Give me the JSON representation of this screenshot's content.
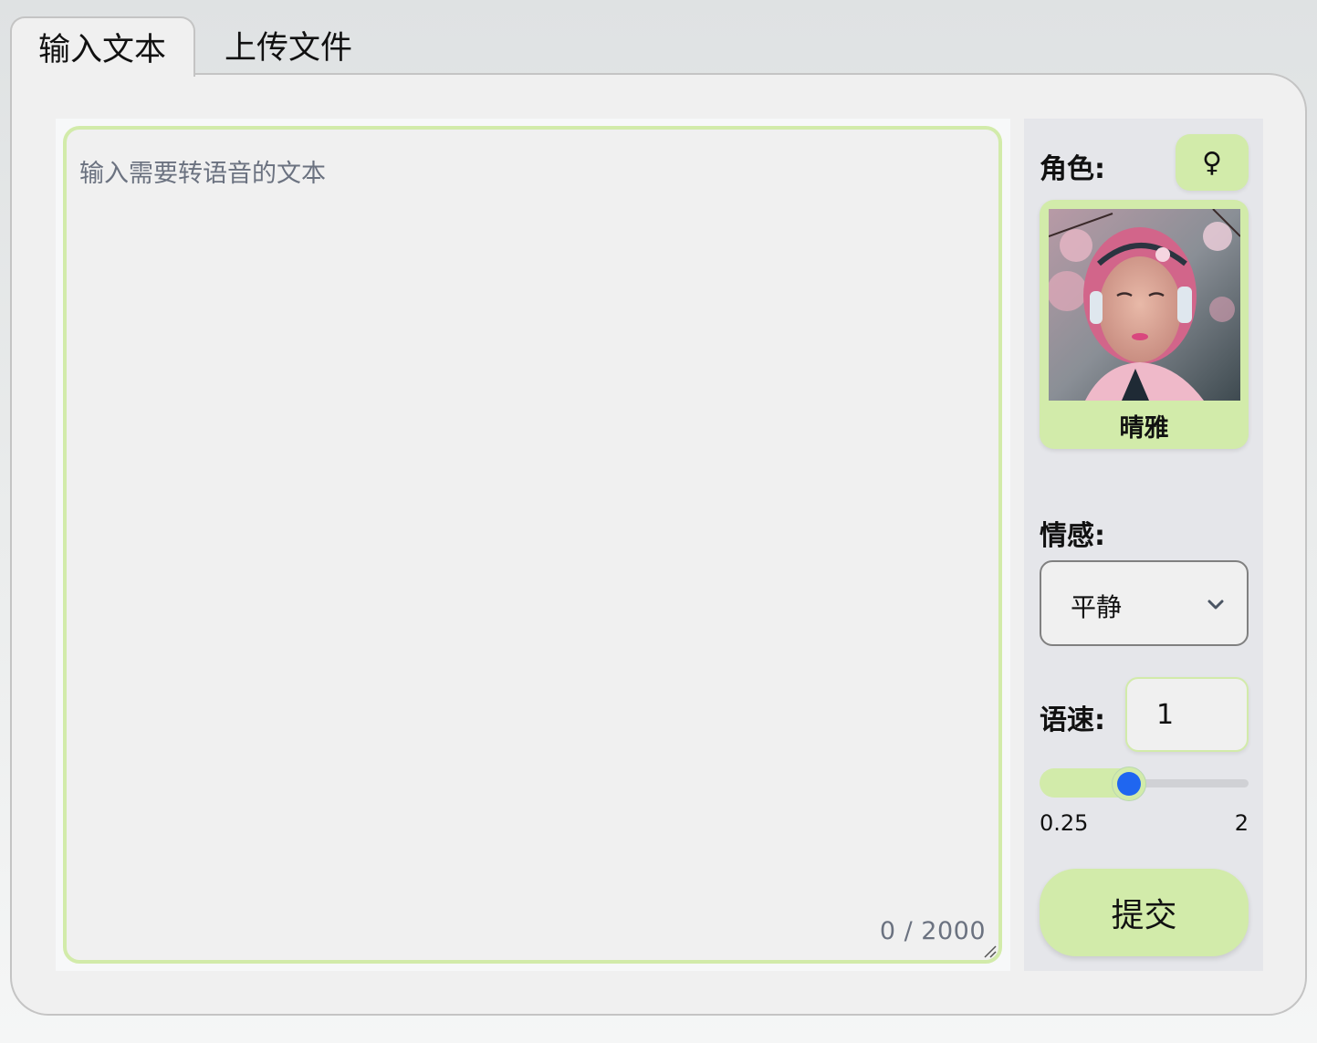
{
  "tabs": [
    {
      "label": "输入文本",
      "active": true
    },
    {
      "label": "上传文件",
      "active": false
    }
  ],
  "editor": {
    "value": "",
    "placeholder": "输入需要转语音的文本",
    "counter": "0 / 2000",
    "max_length": 2000
  },
  "sidebar": {
    "role_label": "角色:",
    "gender_icon": "female-symbol-icon",
    "gender_glyph": "♀",
    "role_name": "晴雅",
    "role_image": "portrait-pink-hair-headphones-cherry-blossom",
    "emotion_label": "情感:",
    "emotion_value": "平静",
    "speed_label": "语速:",
    "speed_value": "1",
    "slider": {
      "min": 0.25,
      "max": 2,
      "value": 1,
      "min_label": "0.25",
      "max_label": "2"
    },
    "submit_label": "提交"
  },
  "colors": {
    "accent": "#d2ebaa",
    "slider_thumb": "#1f66f0",
    "panel_bg": "#f0f0f0",
    "sidebar_bg": "#e5e6ea"
  }
}
